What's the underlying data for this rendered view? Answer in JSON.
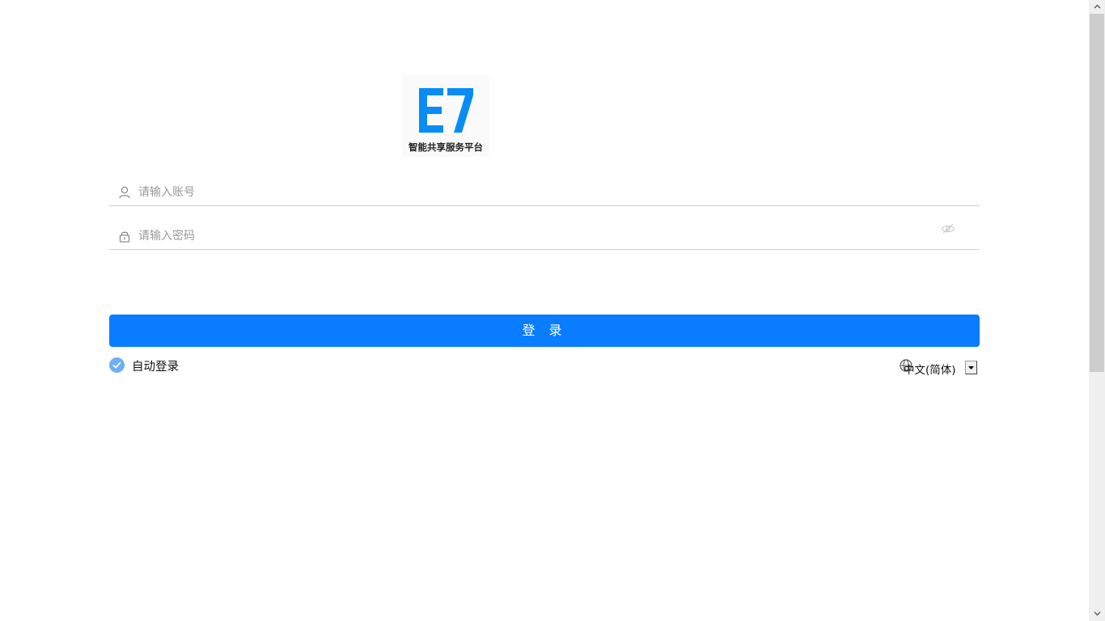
{
  "logo": {
    "mark_text": "E7",
    "tagline": "智能共享服务平台",
    "brand_color": "#0a8cf5"
  },
  "account_field": {
    "placeholder": "请输入账号",
    "value": "",
    "icon": "user-icon"
  },
  "password_field": {
    "placeholder": "请输入密码",
    "value": "",
    "icon": "lock-icon",
    "toggle_icon": "eye-icon"
  },
  "login_button": {
    "label": "登 录",
    "color": "#0a7cff"
  },
  "auto_login": {
    "label": "自动登录",
    "checked": true
  },
  "language": {
    "selected": "中文(简体)",
    "icon": "globe-icon"
  }
}
